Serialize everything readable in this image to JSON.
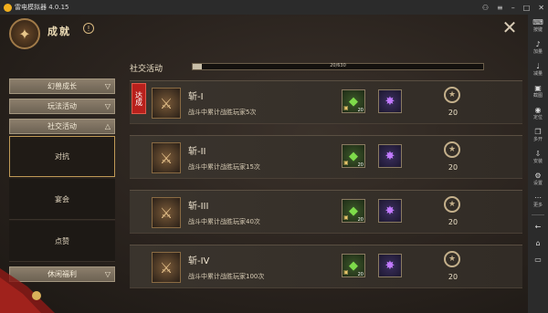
{
  "window": {
    "title": "雷电模拟器 4.0.15"
  },
  "header": {
    "title": "成就",
    "bang": "!"
  },
  "nav": {
    "cats": [
      {
        "label": "幻兽成长"
      },
      {
        "label": "玩法活动"
      },
      {
        "label": "社交活动"
      }
    ],
    "subs": [
      {
        "label": "对抗"
      },
      {
        "label": "宴会"
      },
      {
        "label": "点赞"
      }
    ],
    "bottom_cat": {
      "label": "休闲福利"
    }
  },
  "section": {
    "title": "社交活动",
    "progress_text": "20/630",
    "progress_fraction": 0.032
  },
  "rows": [
    {
      "name": "斩-I",
      "desc": "战斗中累计战胜玩家5次",
      "gem_count": "20",
      "points": "20",
      "stamp": "达成"
    },
    {
      "name": "斩-II",
      "desc": "战斗中累计战胜玩家15次",
      "gem_count": "20",
      "points": "20"
    },
    {
      "name": "斩-III",
      "desc": "战斗中累计战胜玩家40次",
      "gem_count": "20",
      "points": "20"
    },
    {
      "name": "斩-IV",
      "desc": "战斗中累计战胜玩家100次",
      "gem_count": "20",
      "points": "20"
    }
  ],
  "sidebar": [
    {
      "label": "按键",
      "icon": "keyboard-icon"
    },
    {
      "label": "加量",
      "icon": "volume-up-icon"
    },
    {
      "label": "减量",
      "icon": "volume-down-icon"
    },
    {
      "label": "截图",
      "icon": "screenshot-icon"
    },
    {
      "label": "定位",
      "icon": "location-icon"
    },
    {
      "label": "多开",
      "icon": "multi-instance-icon"
    },
    {
      "label": "安装",
      "icon": "install-icon"
    },
    {
      "label": "设置",
      "icon": "settings-icon"
    },
    {
      "label": "更多",
      "icon": "more-icon"
    }
  ]
}
